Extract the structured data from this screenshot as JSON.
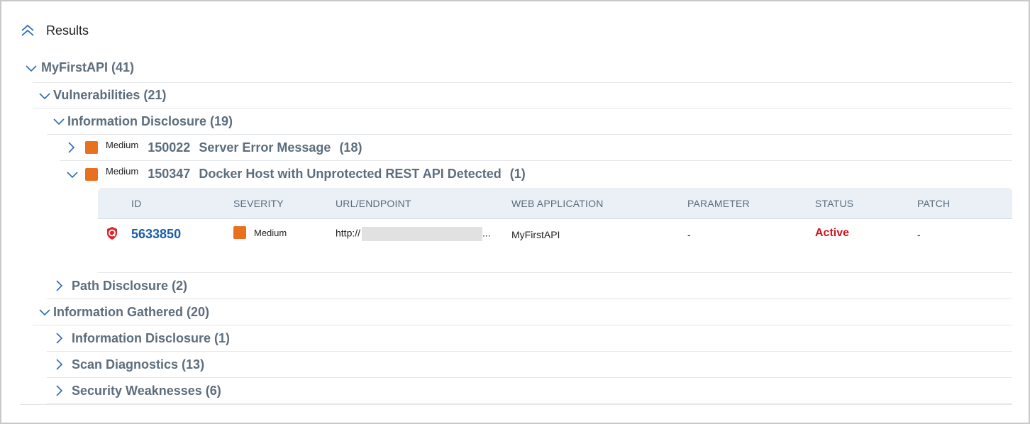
{
  "header": {
    "title": "Results",
    "collapse_icon": "double-chevron-up-icon"
  },
  "tree": {
    "api": "MyFirstAPI (41)",
    "vulnerabilities": "Vulnerabilities (21)",
    "info_disclosure": "Information Disclosure (19)",
    "qid_rows": [
      {
        "severity": "Medium",
        "qid": "150022",
        "title": "Server Error Message",
        "count": "(18)"
      },
      {
        "severity": "Medium",
        "qid": "150347",
        "title": "Docker Host with Unprotected REST API Detected",
        "count": "(1)"
      }
    ],
    "path_disclosure": "Path Disclosure (2)",
    "info_gathered": "Information Gathered (20)",
    "ig_info_disclosure": "Information Disclosure (1)",
    "scan_diagnostics": "Scan Diagnostics (13)",
    "security_weaknesses": "Security Weaknesses (6)"
  },
  "table": {
    "columns": [
      "ID",
      "SEVERITY",
      "URL/ENDPOINT",
      "WEB APPLICATION",
      "PARAMETER",
      "STATUS",
      "PATCH"
    ],
    "row": {
      "id": "5633850",
      "severity": "Medium",
      "url_prefix": "http://",
      "url_suffix": "...",
      "web_app": "MyFirstAPI",
      "parameter": "-",
      "status": "Active",
      "patch": "-"
    }
  },
  "colors": {
    "severity_medium": "#e8711f",
    "status_active": "#d0141c",
    "link": "#1b5ea8"
  }
}
